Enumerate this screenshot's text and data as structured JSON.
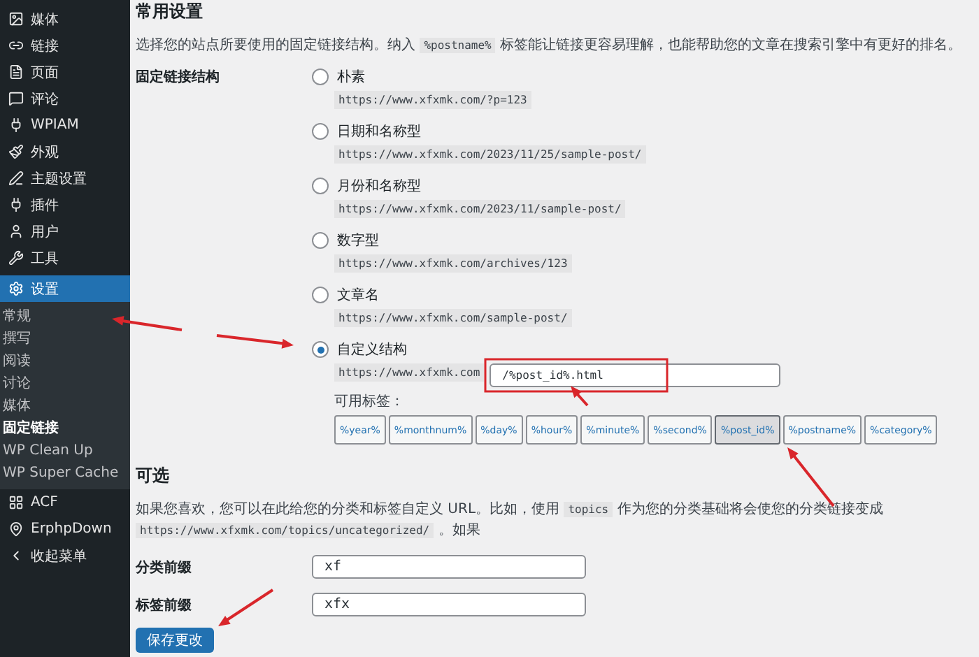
{
  "sidebar": {
    "items": [
      {
        "label": "媒体",
        "selected": false
      },
      {
        "label": "链接",
        "selected": false
      },
      {
        "label": "页面",
        "selected": false
      },
      {
        "label": "评论",
        "selected": false
      },
      {
        "label": "WPIAM",
        "selected": false
      },
      {
        "label": "外观",
        "selected": false
      },
      {
        "label": "主题设置",
        "selected": false
      },
      {
        "label": "插件",
        "selected": false
      },
      {
        "label": "用户",
        "selected": false
      },
      {
        "label": "工具",
        "selected": false
      },
      {
        "label": "设置",
        "selected": true,
        "children": [
          {
            "label": "常规",
            "selected": false
          },
          {
            "label": "撰写",
            "selected": false
          },
          {
            "label": "阅读",
            "selected": false
          },
          {
            "label": "讨论",
            "selected": false
          },
          {
            "label": "媒体",
            "selected": false
          },
          {
            "label": "固定链接",
            "selected": true
          },
          {
            "label": "WP Clean Up",
            "selected": false
          },
          {
            "label": "WP Super Cache",
            "selected": false
          }
        ]
      },
      {
        "label": "ACF",
        "selected": false
      },
      {
        "label": "ErphpDown",
        "selected": false
      },
      {
        "label": "收起菜单",
        "selected": false
      }
    ]
  },
  "common": {
    "title": "常用设置",
    "description": [
      {
        "kind": "text",
        "text": "选择您的站点所要使用的固定链接结构。纳入 "
      },
      {
        "kind": "code",
        "text": "%postname%"
      },
      {
        "kind": "text",
        "text": " 标签能让链接更容易理解，也能帮助您的文章在搜索引擎中有更好的排名。"
      }
    ],
    "label": "固定链接结构",
    "options": [
      {
        "label": "朴素",
        "sample": "https://www.xfxmk.com/?p=123",
        "selected": false
      },
      {
        "label": "日期和名称型",
        "sample": "https://www.xfxmk.com/2023/11/25/sample-post/",
        "selected": false
      },
      {
        "label": "月份和名称型",
        "sample": "https://www.xfxmk.com/2023/11/sample-post/",
        "selected": false
      },
      {
        "label": "数字型",
        "sample": "https://www.xfxmk.com/archives/123",
        "selected": false
      },
      {
        "label": "文章名",
        "sample": "https://www.xfxmk.com/sample-post/",
        "selected": false
      }
    ],
    "custom": {
      "label": "自定义结构",
      "selected": true,
      "prefix": "https://www.xfxmk.com",
      "value": "/%post_id%.html",
      "tags_label": "可用标签：",
      "tags": [
        {
          "label": "%year%",
          "selected": false
        },
        {
          "label": "%monthnum%",
          "selected": false
        },
        {
          "label": "%day%",
          "selected": false
        },
        {
          "label": "%hour%",
          "selected": false
        },
        {
          "label": "%minute%",
          "selected": false
        },
        {
          "label": "%second%",
          "selected": false
        },
        {
          "label": "%post_id%",
          "selected": true
        },
        {
          "label": "%postname%",
          "selected": false
        },
        {
          "label": "%category%",
          "selected": false
        }
      ]
    }
  },
  "optional": {
    "title": "可选",
    "description": [
      {
        "kind": "text",
        "text": "如果您喜欢，您可以在此给您的分类和标签自定义 URL。比如，使用 "
      },
      {
        "kind": "code",
        "text": "topics"
      },
      {
        "kind": "text",
        "text": " 作为您的分类基础将会使您的分类链接变成 "
      },
      {
        "kind": "code",
        "text": "https://www.xfxmk.com/topics/uncategorized/"
      },
      {
        "kind": "text",
        "text": " 。如果"
      }
    ],
    "fields": [
      {
        "label": "分类前缀",
        "value": "xf"
      },
      {
        "label": "标签前缀",
        "value": "xfx"
      }
    ]
  },
  "save_button": "保存更改"
}
